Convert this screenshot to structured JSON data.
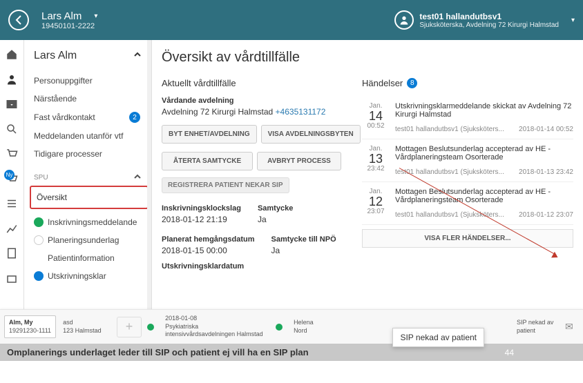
{
  "header": {
    "patient_name": "Lars Alm",
    "patient_id": "19450101-2222",
    "user_name": "test01 hallandutbsv1",
    "user_role": "Sjuksköterska, Avdelning 72 Kirurgi Halmstad"
  },
  "sidebar": {
    "title": "Lars Alm",
    "items": [
      {
        "label": "Personuppgifter"
      },
      {
        "label": "Närstående"
      },
      {
        "label": "Fast vårdkontakt",
        "count": "2"
      },
      {
        "label": "Meddelanden utanför vtf"
      },
      {
        "label": "Tidigare processer"
      }
    ],
    "section_label": "SPU",
    "selected": "Översikt",
    "process": [
      {
        "label": "Inskrivningsmeddelande",
        "status": "green"
      },
      {
        "label": "Planeringsunderlag",
        "status": "white"
      },
      {
        "label": "Patientinformation",
        "status": "none"
      },
      {
        "label": "Utskrivningsklar",
        "status": "blue"
      }
    ],
    "ny_badge": "Ny"
  },
  "content": {
    "title": "Översikt av vårdtillfälle",
    "left": {
      "current_heading": "Aktuellt vårdtillfälle",
      "ward_label": "Vårdande avdelning",
      "ward_name": "Avdelning 72 Kirurgi Halmstad",
      "ward_phone": "+4635131172",
      "btn_change_unit": "BYT ENHET/AVDELNING",
      "btn_show_unit_changes": "VISA AVDELNINGSBYTEN",
      "btn_revoke": "ÅTERTA SAMTYCKE",
      "btn_cancel": "AVBRYT PROCESS",
      "btn_register_deny": "REGISTRERA PATIENT NEKAR SIP",
      "reg_time_label": "Inskrivningsklockslag",
      "reg_time_value": "2018-01-12 21:19",
      "consent_label": "Samtycke",
      "consent_value": "Ja",
      "planned_label": "Planerat hemgångsdatum",
      "planned_value": "2018-01-15 00:00",
      "consent_npo_label": "Samtycke till NPÖ",
      "consent_npo_value": "Ja",
      "discharge_label": "Utskrivningsklardatum"
    },
    "events": {
      "heading": "Händelser",
      "count": "8",
      "list": [
        {
          "mon": "Jan.",
          "day": "14",
          "time": "00:52",
          "title": "Utskrivningsklarmeddelande skickat av Avdelning 72 Kirurgi Halmstad",
          "user": "test01 hallandutbsv1 (Sjuksköters...",
          "ts": "2018-01-14 00:52"
        },
        {
          "mon": "Jan.",
          "day": "13",
          "time": "23:42",
          "title": "Mottagen Beslutsunderlag accepterad av HE - Vårdplaneringsteam Osorterade",
          "user": "test01 hallandutbsv1 (Sjuksköters...",
          "ts": "2018-01-13 23:42"
        },
        {
          "mon": "Jan.",
          "day": "12",
          "time": "23:07",
          "title": "Mottagen Beslutsunderlag accepterad av HE - Vårdplaneringsteam Osorterade",
          "user": "test01 hallandutbsv1 (Sjuksköters...",
          "ts": "2018-01-12 23:07"
        }
      ],
      "more": "VISA FLER HÄNDELSER..."
    }
  },
  "bottom": {
    "box_name": "Alm, My",
    "box_id": "19291230-1111",
    "asd": "asd",
    "asd_loc": "123 Halmstad",
    "ward_date": "2018-01-08",
    "ward_name": "Psykiatriska intensivvårdsavdelningen Halmstad",
    "person": "Helena Nord",
    "sip": "SIP nekad av patient",
    "tooltip": "SIP nekad av patient"
  },
  "footer": {
    "text": "Omplanerings underlaget leder till SIP och patient ej vill ha en SIP plan",
    "page": "44"
  }
}
